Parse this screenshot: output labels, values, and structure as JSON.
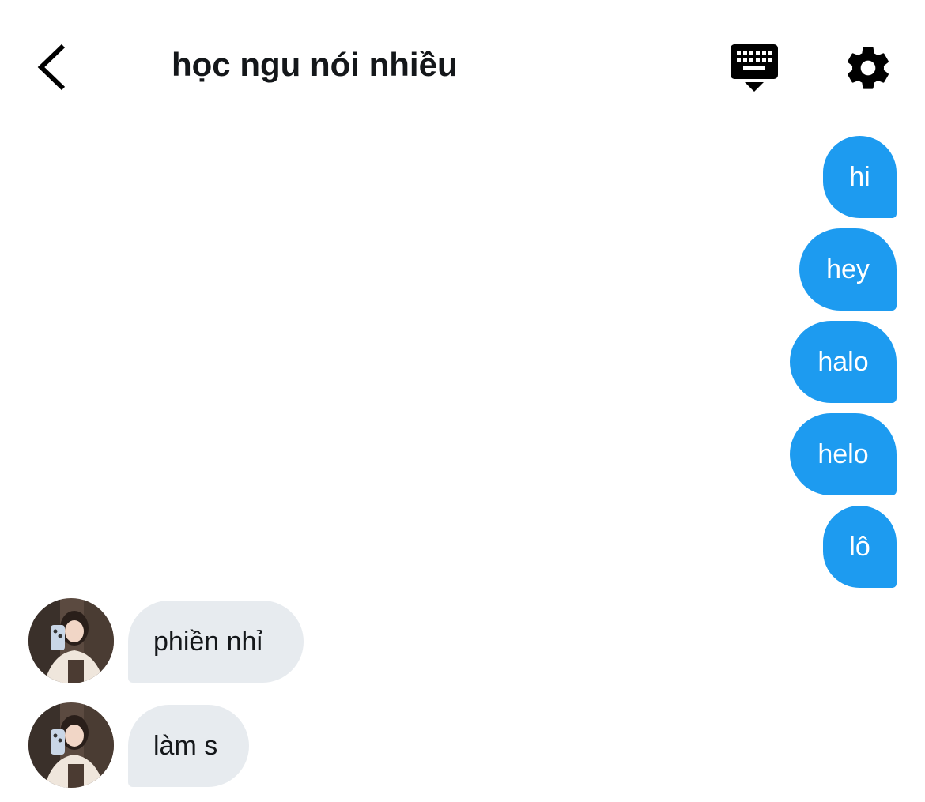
{
  "header": {
    "title": "học ngu nói nhiều",
    "back_icon": "chevron-left-icon",
    "keyboard_icon": "keyboard-hide-icon",
    "settings_icon": "gear-icon"
  },
  "messages_out": [
    {
      "text": "hi"
    },
    {
      "text": "hey"
    },
    {
      "text": "halo"
    },
    {
      "text": "helo"
    },
    {
      "text": "lô"
    }
  ],
  "messages_in": [
    {
      "text": "phiền nhỉ"
    },
    {
      "text": "làm s"
    }
  ],
  "colors": {
    "outgoing_bubble": "#1d9bf0",
    "incoming_bubble": "#e7ebef",
    "title_text": "#14171a"
  }
}
